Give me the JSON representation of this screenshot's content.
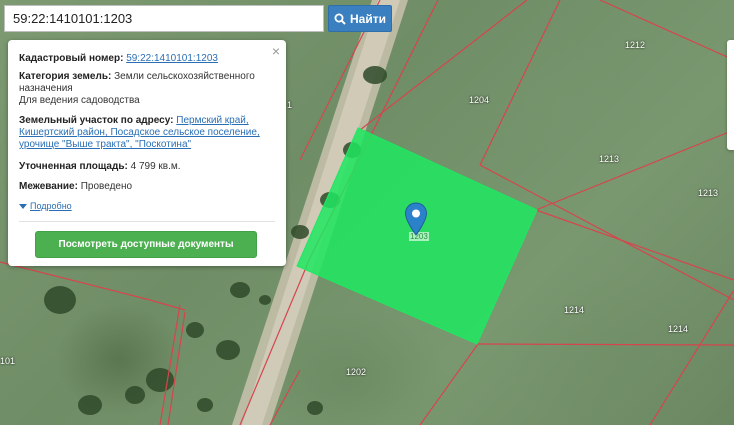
{
  "search": {
    "value": "59:22:1410101:1203",
    "button_label": "Найти",
    "button_icon": "search-icon"
  },
  "popup": {
    "cadastral_label": "Кадастровый номер:",
    "cadastral_value": "59:22:1410101:1203",
    "category_label": "Категория земель:",
    "category_value_line1": "Земли сельскохозяйственного",
    "category_value_line2": "назначения",
    "purpose": "Для ведения садоводства",
    "address_label": "Земельный участок по адресу:",
    "address_line1": "Пермский край,",
    "address_line2": "Кишертский район, Посадское сельское поселение,",
    "address_line3": "урочище \"Выше тракта\", \"Поскотина\"",
    "area_label": "Уточненная площадь:",
    "area_value": "4 799 кв.м.",
    "survey_label": "Межевание:",
    "survey_value": "Проведено",
    "more_label": "Подробно",
    "docs_button": "Посмотреть доступные документы",
    "close_symbol": "×"
  },
  "map": {
    "parcel_labels": [
      "1212",
      "1204",
      "1213",
      "1213",
      "1214",
      "1214",
      "1202",
      "101",
      "1",
      "1203"
    ],
    "colors": {
      "parcel_border": "#d6454d",
      "selected_fill": "#1ee860",
      "marker": "#2b82cb"
    }
  }
}
